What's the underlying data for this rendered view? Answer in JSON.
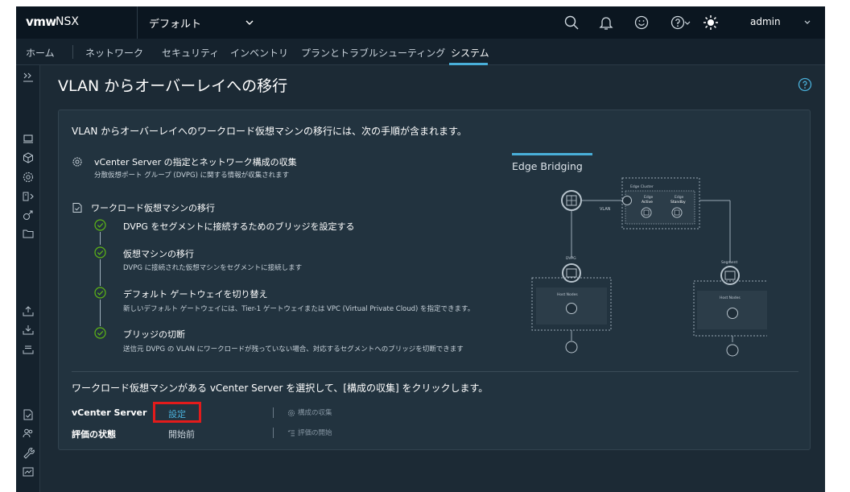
{
  "header": {
    "logo": "vmw",
    "product": "NSX",
    "project": "デフォルト",
    "user": "admin"
  },
  "nav": {
    "items": [
      "ホーム",
      "ネットワーク",
      "セキュリティ",
      "インベントリ",
      "プランとトラブルシューティング",
      "システム"
    ],
    "active": "システム"
  },
  "page": {
    "title": "VLAN からオーバーレイへの移行"
  },
  "card": {
    "intro": "VLAN からオーバーレイへのワークロード仮想マシンの移行には、次の手順が含まれます。",
    "step1": {
      "title": "vCenter Server の指定とネットワーク構成の収集",
      "desc": "分散仮想ポート グループ (DVPG) に関する情報が収集されます"
    },
    "step2": {
      "title": "ワークロード仮想マシンの移行",
      "substeps": [
        {
          "title": "DVPG をセグメントに接続するためのブリッジを設定する",
          "desc": ""
        },
        {
          "title": "仮想マシンの移行",
          "desc": "DVPG に接続された仮想マシンをセグメントに接続します"
        },
        {
          "title": "デフォルト ゲートウェイを切り替え",
          "desc": "新しいデフォルト ゲートウェイには、Tier-1 ゲートウェイまたは VPC (Virtual Private Cloud) を指定できます。"
        },
        {
          "title": "ブリッジの切断",
          "desc": "送信元 DVPG の VLAN にワークロードが残っていない場合、対応するセグメントへのブリッジを切断できます"
        }
      ]
    },
    "diagram": {
      "title": "Edge Bridging",
      "edge_cluster": "Edge Cluster",
      "edge_active": "Edge",
      "active_label": "Active",
      "edge_standby": "Edge",
      "standby_label": "Standby",
      "vlan": "VLAN",
      "dvpg": "DVPG",
      "segment": "Segment",
      "host_nodes_left": "Host Nodes",
      "host_nodes_right": "Host Nodes"
    },
    "instruction": "ワークロード仮想マシンがある vCenter Server を選択して、[構成の収集] をクリックします。",
    "vcenter_label": "vCenter Server",
    "vcenter_link": "設定",
    "collect_action": "構成の収集",
    "status_label": "評価の状態",
    "status_value": "開始前",
    "start_action": "評価の開始"
  },
  "colors": {
    "accent": "#49afd9",
    "check_green": "#5eb715",
    "highlight_red": "#e31b1b"
  }
}
